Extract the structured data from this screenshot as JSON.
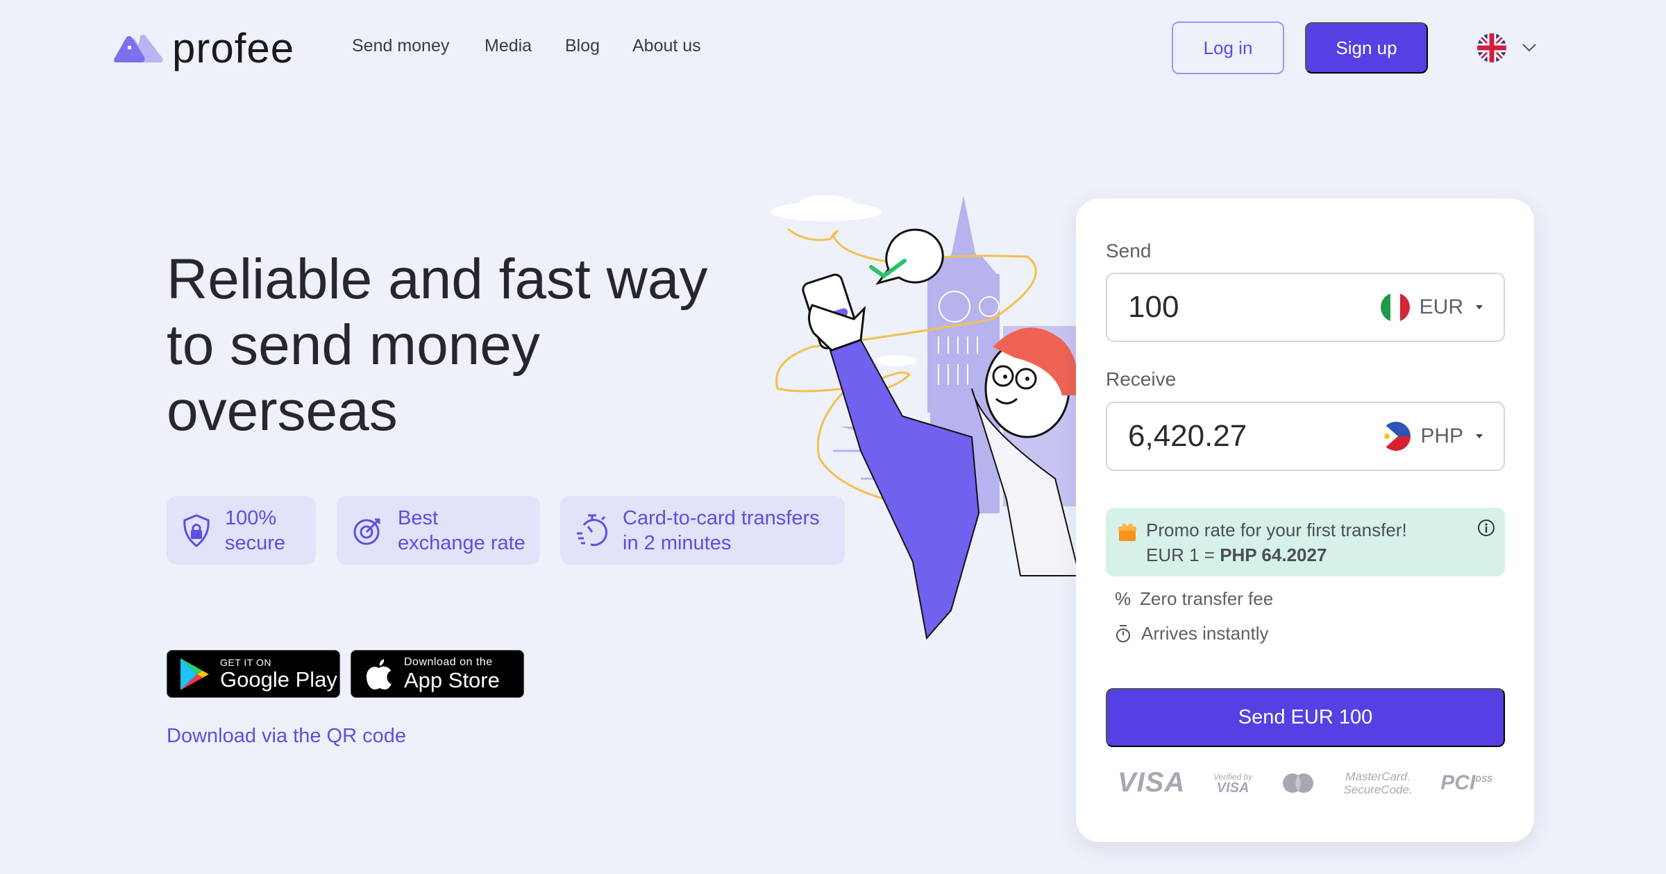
{
  "header": {
    "logo_text": "profee",
    "nav": [
      "Send money",
      "Media",
      "Blog",
      "About us"
    ],
    "login_label": "Log in",
    "signup_label": "Sign up",
    "language_icon": "uk-flag-icon"
  },
  "hero": {
    "title_lines": [
      "Reliable and fast way",
      "to send money",
      "overseas"
    ],
    "features": [
      {
        "icon": "shield-lock-icon",
        "line1": "100%",
        "line2": "secure"
      },
      {
        "icon": "exchange-target-icon",
        "line1": "Best",
        "line2": "exchange rate"
      },
      {
        "icon": "stopwatch-icon",
        "line1": "Card-to-card transfers",
        "line2": "in 2 minutes"
      }
    ],
    "google_play": {
      "small": "GET IT ON",
      "big": "Google Play"
    },
    "app_store": {
      "small": "Download on the",
      "big": "App Store"
    },
    "qr_link": "Download via the QR code"
  },
  "calculator": {
    "send_label": "Send",
    "send_value": "100",
    "send_currency": "EUR",
    "receive_label": "Receive",
    "receive_value": "6,420.27",
    "receive_currency": "PHP",
    "promo_title": "Promo rate for your first transfer!",
    "promo_rate_prefix": "EUR 1 = ",
    "promo_rate_value": "PHP 64.2027",
    "fee_text": "Zero transfer fee",
    "arrival_text": "Arrives instantly",
    "send_button": "Send EUR 100",
    "payment_logos": [
      "VISA",
      "Verified by VISA",
      "Mastercard",
      "MasterCard SecureCode",
      "PCI DSS"
    ]
  },
  "colors": {
    "accent": "#5540e3",
    "background": "#eef0fa",
    "chip_bg": "#e2e2f8",
    "promo_bg": "#d5f1ea"
  }
}
